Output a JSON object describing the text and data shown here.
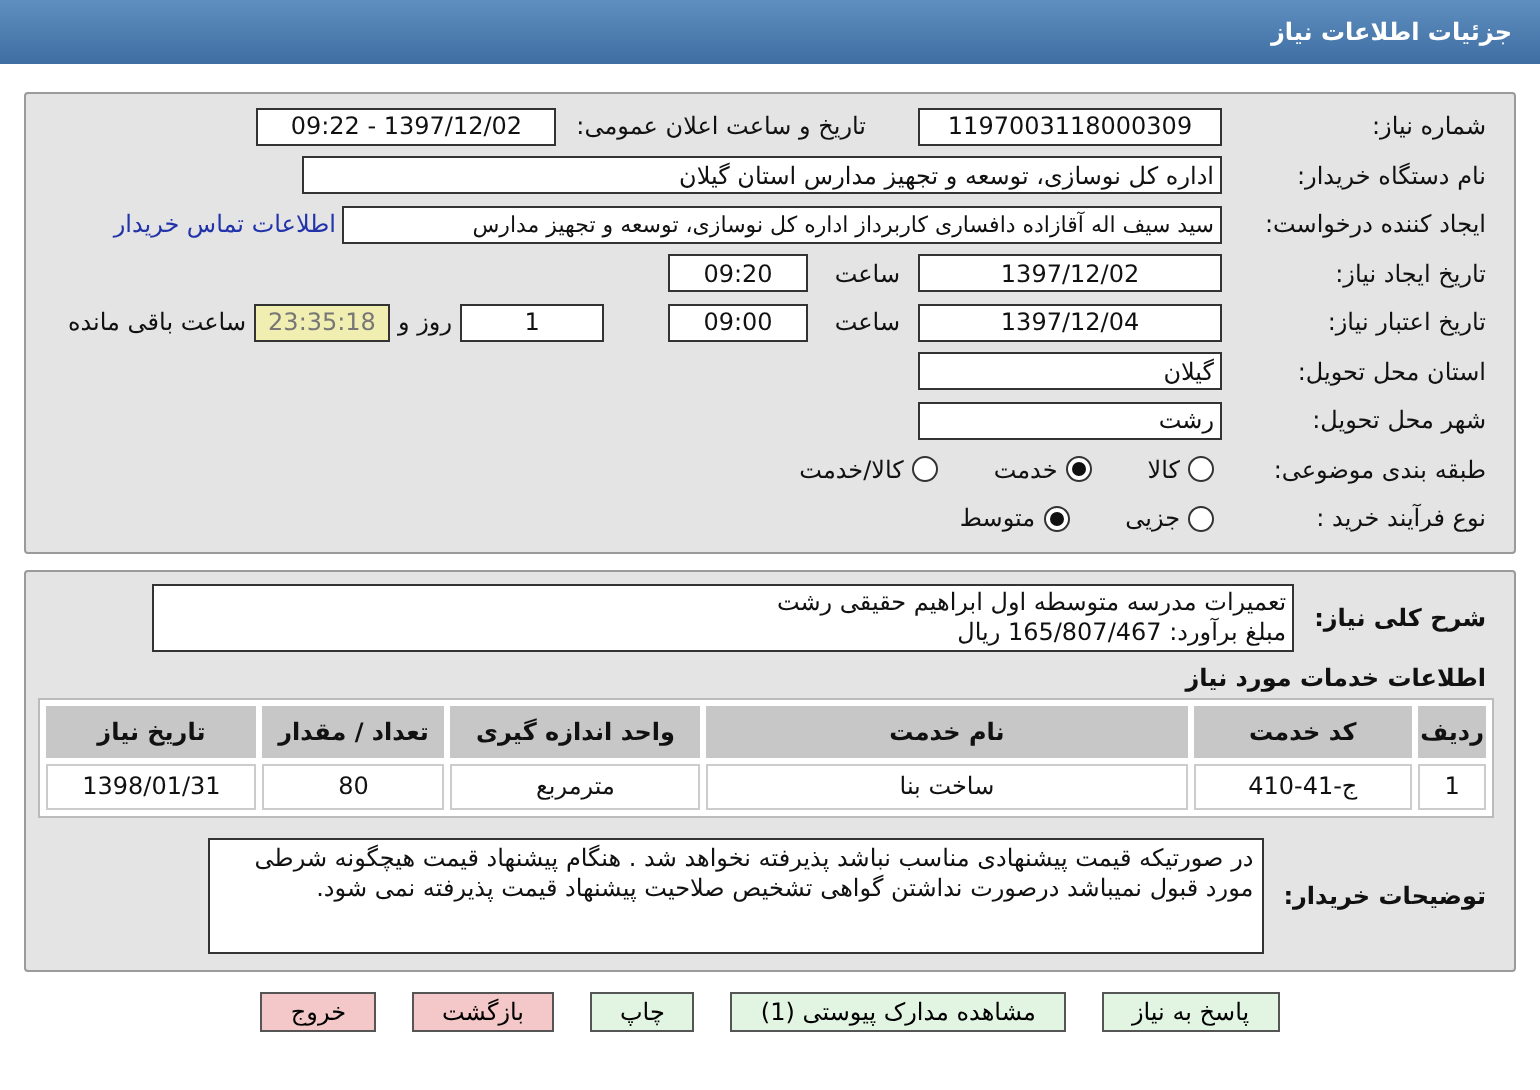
{
  "header": {
    "title": "جزئیات اطلاعات نیاز"
  },
  "details": {
    "need_number": {
      "label": "شماره نیاز:",
      "value": "1197003118000309"
    },
    "announce": {
      "label": "تاریخ و ساعت اعلان عمومی:",
      "value": "1397/12/02 - 09:22"
    },
    "buyer_org": {
      "label": "نام دستگاه خریدار:",
      "value": "اداره کل نوسازی، توسعه و تجهیز مدارس استان گیلان"
    },
    "requester": {
      "label": "ایجاد کننده درخواست:",
      "value": "سید سیف اله آقازاده دافساری کاربرداز اداره کل نوسازی، توسعه و تجهیز مدارس",
      "contact_link": "اطلاعات تماس خریدار"
    },
    "created": {
      "label": "تاریخ ایجاد نیاز:",
      "date": "1397/12/02",
      "time_label": "ساعت",
      "time": "09:20"
    },
    "validity": {
      "label": "تاریخ اعتبار نیاز:",
      "date": "1397/12/04",
      "time_label": "ساعت",
      "time": "09:00",
      "days": "1",
      "days_label": "روز و",
      "remaining": "23:35:18",
      "remaining_label": "ساعت باقی مانده"
    },
    "province": {
      "label": "استان محل تحویل:",
      "value": "گیلان"
    },
    "city": {
      "label": "شهر محل تحویل:",
      "value": "رشت"
    },
    "category": {
      "label": "طبقه بندی موضوعی:",
      "options": [
        {
          "label": "کالا",
          "selected": false
        },
        {
          "label": "خدمت",
          "selected": true
        },
        {
          "label": "کالا/خدمت",
          "selected": false
        }
      ]
    },
    "purchase_type": {
      "label": "نوع فرآیند خرید :",
      "options": [
        {
          "label": "جزیی",
          "selected": false
        },
        {
          "label": "متوسط",
          "selected": true
        }
      ]
    }
  },
  "summary": {
    "label": "شرح کلی نیاز:",
    "lines": [
      "تعمیرات مدرسه متوسطه اول ابراهیم حقیقی رشت",
      "مبلغ برآورد: 165/807/467 ریال"
    ]
  },
  "services": {
    "title": "اطلاعات خدمات مورد نیاز",
    "columns": [
      "ردیف",
      "کد خدمت",
      "نام خدمت",
      "واحد اندازه گیری",
      "تعداد / مقدار",
      "تاریخ نیاز"
    ],
    "rows": [
      [
        "1",
        "ج-41-410",
        "ساخت بنا",
        "مترمربع",
        "80",
        "1398/01/31"
      ]
    ]
  },
  "buyer_notes": {
    "label": "توضیحات خریدار:",
    "text": "در صورتیکه قیمت پیشنهادی مناسب نباشد پذیرفته نخواهد شد . هنگام پیشنهاد قیمت هیچگونه شرطی مورد قبول نمیباشد  درصورت نداشتن گواهی تشخیص صلاحیت پیشنهاد قیمت پذیرفته نمی شود."
  },
  "buttons": [
    {
      "label": "پاسخ به نیاز",
      "kind": "action"
    },
    {
      "label": "مشاهده مدارک پیوستی (1)",
      "kind": "action"
    },
    {
      "label": "چاپ",
      "kind": "action"
    },
    {
      "label": "بازگشت",
      "kind": "danger"
    },
    {
      "label": "خروج",
      "kind": "danger"
    }
  ]
}
